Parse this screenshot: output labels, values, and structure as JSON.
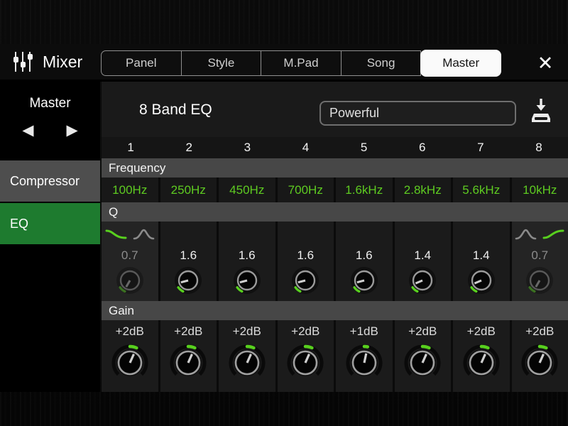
{
  "window": {
    "title": "Mixer",
    "close_glyph": "✕"
  },
  "tabs": [
    {
      "label": "Panel"
    },
    {
      "label": "Style"
    },
    {
      "label": "M.Pad"
    },
    {
      "label": "Song"
    },
    {
      "label": "Master",
      "active": true
    }
  ],
  "sidebar": {
    "part_selector": {
      "label": "Master",
      "prev_glyph": "◀",
      "next_glyph": "▶"
    },
    "items": [
      {
        "label": "Compressor",
        "active": false
      },
      {
        "label": "EQ",
        "active": true
      }
    ]
  },
  "eq": {
    "title": "8 Band EQ",
    "preset": "Powerful",
    "row_labels": {
      "frequency": "Frequency",
      "q": "Q",
      "gain": "Gain"
    },
    "bands": [
      {
        "number": "1",
        "frequency": "100Hz",
        "q": "0.7",
        "q_enabled": false,
        "filter_type": "low-shelf",
        "gain": "+2dB"
      },
      {
        "number": "2",
        "frequency": "250Hz",
        "q": "1.6",
        "q_enabled": true,
        "filter_type": "peak",
        "gain": "+2dB"
      },
      {
        "number": "3",
        "frequency": "450Hz",
        "q": "1.6",
        "q_enabled": true,
        "filter_type": "peak",
        "gain": "+2dB"
      },
      {
        "number": "4",
        "frequency": "700Hz",
        "q": "1.6",
        "q_enabled": true,
        "filter_type": "peak",
        "gain": "+2dB"
      },
      {
        "number": "5",
        "frequency": "1.6kHz",
        "q": "1.6",
        "q_enabled": true,
        "filter_type": "peak",
        "gain": "+1dB"
      },
      {
        "number": "6",
        "frequency": "2.8kHz",
        "q": "1.4",
        "q_enabled": true,
        "filter_type": "peak",
        "gain": "+2dB"
      },
      {
        "number": "7",
        "frequency": "5.6kHz",
        "q": "1.4",
        "q_enabled": true,
        "filter_type": "peak",
        "gain": "+2dB"
      },
      {
        "number": "8",
        "frequency": "10kHz",
        "q": "0.7",
        "q_enabled": false,
        "filter_type": "high-shelf",
        "gain": "+2dB"
      }
    ]
  },
  "colors": {
    "accent_green": "#1e7b2f",
    "value_green": "#5ecb21",
    "strip_gray": "#474747",
    "active_tab_bg": "#fafafa",
    "panel_bg": "#1a1a1a"
  }
}
